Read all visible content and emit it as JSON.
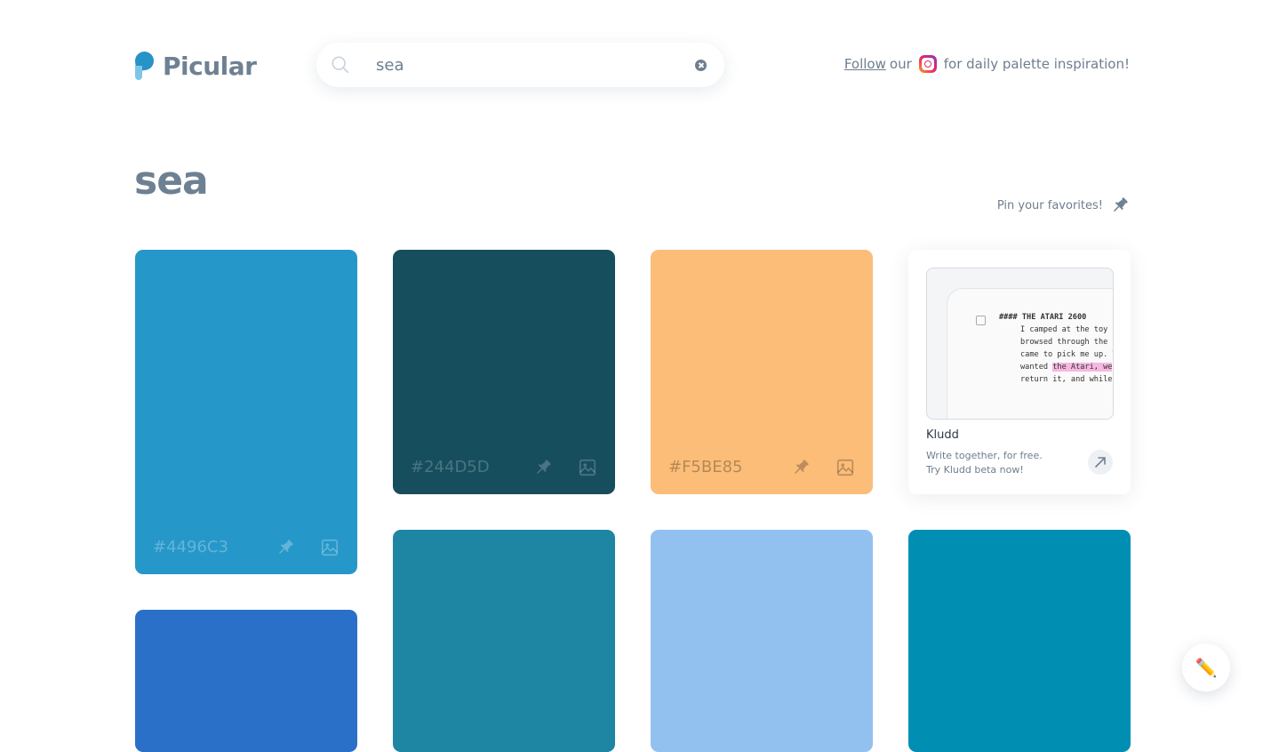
{
  "header": {
    "logo_text": "Picular",
    "search": {
      "value": "sea",
      "placeholder": ""
    },
    "follow": {
      "link": "Follow",
      "our": "our",
      "tail": "for daily palette inspiration!"
    }
  },
  "query_title": "sea",
  "pin_favorites": "Pin your favorites!",
  "swatches": [
    {
      "hex": "#4496C3",
      "color": "#2697c9",
      "hex_label": "#4496C3"
    },
    {
      "hex": "#244D5D",
      "color": "#174e5e",
      "hex_label": "#244D5D"
    },
    {
      "hex": "#F5BE85",
      "color": "#fbbd78",
      "hex_label": "#F5BE85"
    },
    {
      "color": "#2a70c8"
    },
    {
      "color": "#1e85a3"
    },
    {
      "color": "#92c1f0"
    },
    {
      "color": "#008fb3"
    }
  ],
  "ad": {
    "title": "Kludd",
    "line1": "Write together, for free.",
    "line2": "Try Kludd beta now!",
    "doc_heading": "#### THE ATARI 2600",
    "doc_lines": [
      "I camped at the toy s",
      "browsed through the g",
      "came to pick me up. T",
      "return it, and while"
    ],
    "doc_line4_pre": "wanted ",
    "doc_line4_hl": "the Atari, we"
  },
  "fab_icon": "pencil-icon"
}
